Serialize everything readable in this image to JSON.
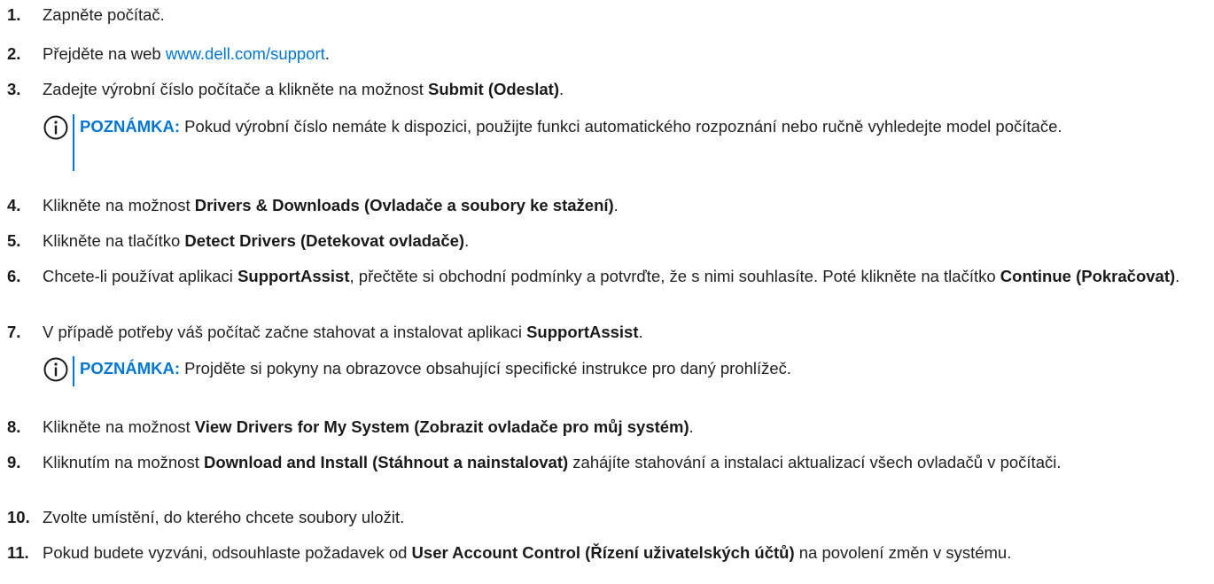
{
  "steps": [
    {
      "num": "1.",
      "parts": [
        {
          "t": "Zapněte počítač."
        }
      ]
    },
    {
      "num": "2.",
      "parts": [
        {
          "t": "Přejděte na web "
        },
        {
          "t": "www.dell.com/support",
          "link": true
        },
        {
          "t": "."
        }
      ]
    },
    {
      "num": "3.",
      "parts": [
        {
          "t": "Zadejte výrobní číslo počítače a klikněte na možnost "
        },
        {
          "t": "Submit (Odeslat)",
          "b": true
        },
        {
          "t": "."
        }
      ]
    },
    {
      "num": "4.",
      "parts": [
        {
          "t": "Klikněte na možnost "
        },
        {
          "t": "Drivers & Downloads (Ovladače a soubory ke stažení)",
          "b": true
        },
        {
          "t": "."
        }
      ]
    },
    {
      "num": "5.",
      "parts": [
        {
          "t": "Klikněte na tlačítko "
        },
        {
          "t": "Detect Drivers (Detekovat ovladače)",
          "b": true
        },
        {
          "t": "."
        }
      ]
    },
    {
      "num": "6.",
      "parts": [
        {
          "t": "Chcete-li používat aplikaci "
        },
        {
          "t": "SupportAssist",
          "b": true
        },
        {
          "t": ", přečtěte si obchodní podmínky a potvrďte, že s nimi souhlasíte. Poté klikněte na tlačítko "
        },
        {
          "t": "Continue (Pokračovat)",
          "b": true
        },
        {
          "t": "."
        }
      ]
    },
    {
      "num": "7.",
      "parts": [
        {
          "t": "V případě potřeby váš počítač začne stahovat a instalovat aplikaci "
        },
        {
          "t": "SupportAssist",
          "b": true
        },
        {
          "t": "."
        }
      ]
    },
    {
      "num": "8.",
      "parts": [
        {
          "t": "Klikněte na možnost "
        },
        {
          "t": "View Drivers for My System (Zobrazit ovladače pro můj systém)",
          "b": true
        },
        {
          "t": "."
        }
      ]
    },
    {
      "num": "9.",
      "parts": [
        {
          "t": "Kliknutím na možnost "
        },
        {
          "t": "Download and Install (Stáhnout a nainstalovat)",
          "b": true
        },
        {
          "t": " zahájíte stahování a instalaci aktualizací všech ovladačů v počítači."
        }
      ]
    },
    {
      "num": "10.",
      "parts": [
        {
          "t": "Zvolte umístění, do kterého chcete soubory uložit."
        }
      ]
    },
    {
      "num": "11.",
      "parts": [
        {
          "t": "Pokud budete vyzváni, odsouhlaste požadavek od "
        },
        {
          "t": "User Account Control (Řízení uživatelských účtů)",
          "b": true
        },
        {
          "t": " na povolení změn v systému."
        }
      ]
    }
  ],
  "notes": [
    {
      "label": "POZNÁMKA:",
      "text": " Pokud výrobní číslo nemáte k dispozici, použijte funkci automatického rozpoznání nebo ručně vyhledejte model počítače."
    },
    {
      "label": "POZNÁMKA:",
      "text": " Projděte si pokyny na obrazovce obsahující specifické instrukce pro daný prohlížeč."
    }
  ],
  "icons": {
    "note": "info-icon"
  },
  "colors": {
    "accent": "#0076ce",
    "text": "#222222"
  }
}
